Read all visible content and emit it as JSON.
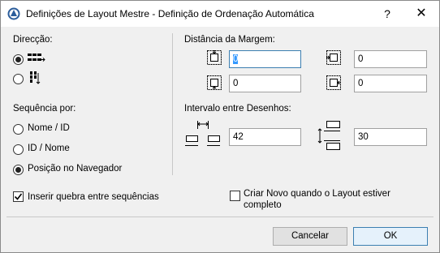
{
  "window": {
    "title": "Definições de Layout Mestre - Definição de Ordenação Automática",
    "help": "?",
    "close": "✕"
  },
  "direction": {
    "label": "Direcção:",
    "options": [
      {
        "icon": "horizontal-order-icon",
        "selected": true
      },
      {
        "icon": "vertical-order-icon",
        "selected": false
      }
    ]
  },
  "sequence": {
    "label": "Sequência por:",
    "options": [
      {
        "label": "Nome / ID",
        "selected": false
      },
      {
        "label": "ID / Nome",
        "selected": false
      },
      {
        "label": "Posição no Navegador",
        "selected": true
      }
    ]
  },
  "margins": {
    "label": "Distância da Margem:",
    "top": "0",
    "right": "0",
    "bottom": "0",
    "left": "0"
  },
  "spacing": {
    "label": "Intervalo entre Desenhos:",
    "horizontal": "42",
    "vertical": "30"
  },
  "options": {
    "insert_break": {
      "label": "Inserir quebra entre sequências",
      "checked": true
    },
    "create_new": {
      "label": "Criar Novo quando o Layout estiver completo",
      "line1": "Criar Novo quando o Layout estiver",
      "line2": "completo",
      "checked": false
    }
  },
  "buttons": {
    "cancel": "Cancelar",
    "ok": "OK"
  },
  "colors": {
    "accent": "#3399ff",
    "focus_border": "#3c7fb1"
  }
}
